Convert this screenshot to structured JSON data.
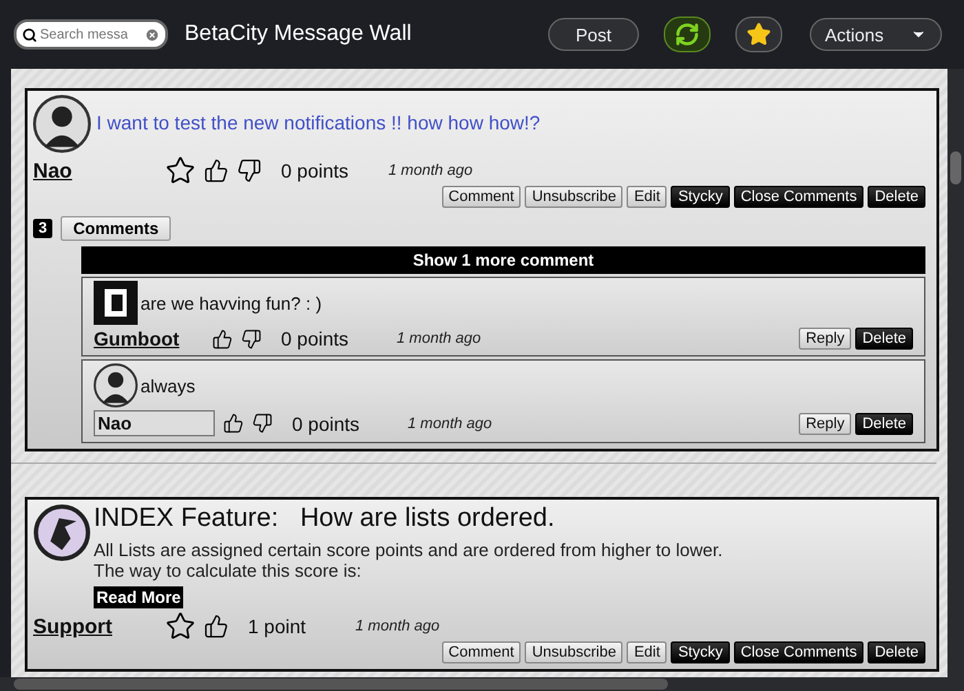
{
  "topbar": {
    "search": {
      "placeholder": "Search messa"
    },
    "title": "BetaCity Message Wall",
    "post_button": "Post",
    "actions_button": "Actions"
  },
  "posts": [
    {
      "author": "Nao",
      "kind": "mask",
      "message": "I want to test the new notifications !! how how how!?",
      "star": true,
      "thumbs_up": true,
      "thumbs_down": true,
      "points": "0 points",
      "time": "1 month ago",
      "buttons": [
        {
          "label": "Comment",
          "kind": "light"
        },
        {
          "label": "Unsubscribe",
          "kind": "light"
        },
        {
          "label": "Edit",
          "kind": "light"
        },
        {
          "label": "Stycky",
          "kind": "dark"
        },
        {
          "label": "Close Comments",
          "kind": "dark"
        },
        {
          "label": "Delete",
          "kind": "dark"
        }
      ],
      "comment_count": "3",
      "comments_button": "Comments",
      "show_more": "Show 1 more comment",
      "comments": [
        {
          "author": "Gumboot",
          "author_boxed": false,
          "kind": "square",
          "text": "are we havving fun? : )",
          "points": "0 points",
          "time": "1 month ago",
          "buttons": [
            {
              "label": "Reply",
              "kind": "light"
            },
            {
              "label": "Delete",
              "kind": "dark"
            }
          ]
        },
        {
          "author": "Nao",
          "author_boxed": true,
          "kind": "mask",
          "text": "always",
          "points": "0 points",
          "time": "1 month ago",
          "buttons": [
            {
              "label": "Reply",
              "kind": "light"
            },
            {
              "label": "Delete",
              "kind": "dark"
            }
          ]
        }
      ]
    },
    {
      "author": "Support",
      "kind": "logo",
      "title": "INDEX Feature:   How are lists ordered.",
      "body": "All Lists are assigned certain score points and are ordered from higher to lower.\nThe way to calculate this score is:",
      "read_more": "Read More",
      "star": true,
      "thumbs_up": true,
      "thumbs_down": false,
      "points": "1 point",
      "time": "1 month ago",
      "buttons": [
        {
          "label": "Comment",
          "kind": "light"
        },
        {
          "label": "Unsubscribe",
          "kind": "light"
        },
        {
          "label": "Edit",
          "kind": "light"
        },
        {
          "label": "Stycky",
          "kind": "dark"
        },
        {
          "label": "Close Comments",
          "kind": "dark"
        },
        {
          "label": "Delete",
          "kind": "dark"
        }
      ]
    }
  ]
}
